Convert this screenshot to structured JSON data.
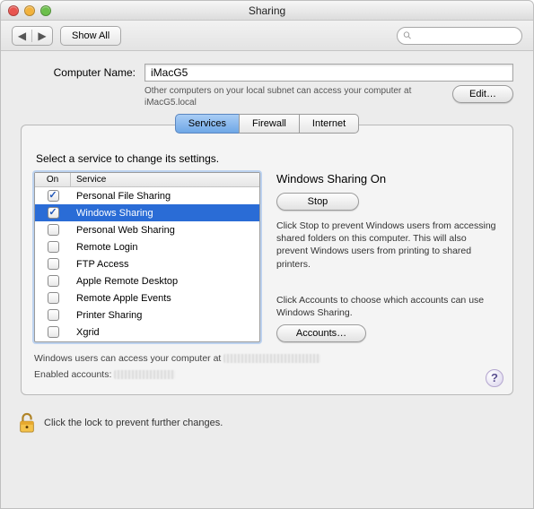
{
  "window": {
    "title": "Sharing"
  },
  "toolbar": {
    "show_all": "Show All",
    "search_placeholder": ""
  },
  "name_section": {
    "label": "Computer Name:",
    "value": "iMacG5",
    "note": "Other computers on your local subnet can access your computer at iMacG5.local",
    "edit_label": "Edit…"
  },
  "tabs": [
    "Services",
    "Firewall",
    "Internet"
  ],
  "tabs_selected_index": 0,
  "instruction": "Select a service to change its settings.",
  "table": {
    "col_on": "On",
    "col_service": "Service",
    "rows": [
      {
        "on": true,
        "name": "Personal File Sharing",
        "selected": false
      },
      {
        "on": true,
        "name": "Windows Sharing",
        "selected": true
      },
      {
        "on": false,
        "name": "Personal Web Sharing",
        "selected": false
      },
      {
        "on": false,
        "name": "Remote Login",
        "selected": false
      },
      {
        "on": false,
        "name": "FTP Access",
        "selected": false
      },
      {
        "on": false,
        "name": "Apple Remote Desktop",
        "selected": false
      },
      {
        "on": false,
        "name": "Remote Apple Events",
        "selected": false
      },
      {
        "on": false,
        "name": "Printer Sharing",
        "selected": false
      },
      {
        "on": false,
        "name": "Xgrid",
        "selected": false
      }
    ]
  },
  "detail": {
    "status": "Windows Sharing On",
    "stop_label": "Stop",
    "stop_hint": "Click Stop to prevent Windows users from accessing shared folders on this computer. This will also prevent Windows users from printing to shared printers.",
    "accounts_hint": "Click Accounts to choose which accounts can use Windows Sharing.",
    "accounts_label": "Accounts…"
  },
  "footer": {
    "access_line": "Windows users can access your computer at ",
    "enabled_line": "Enabled accounts:"
  },
  "help_symbol": "?",
  "lock_line": "Click the lock to prevent further changes."
}
